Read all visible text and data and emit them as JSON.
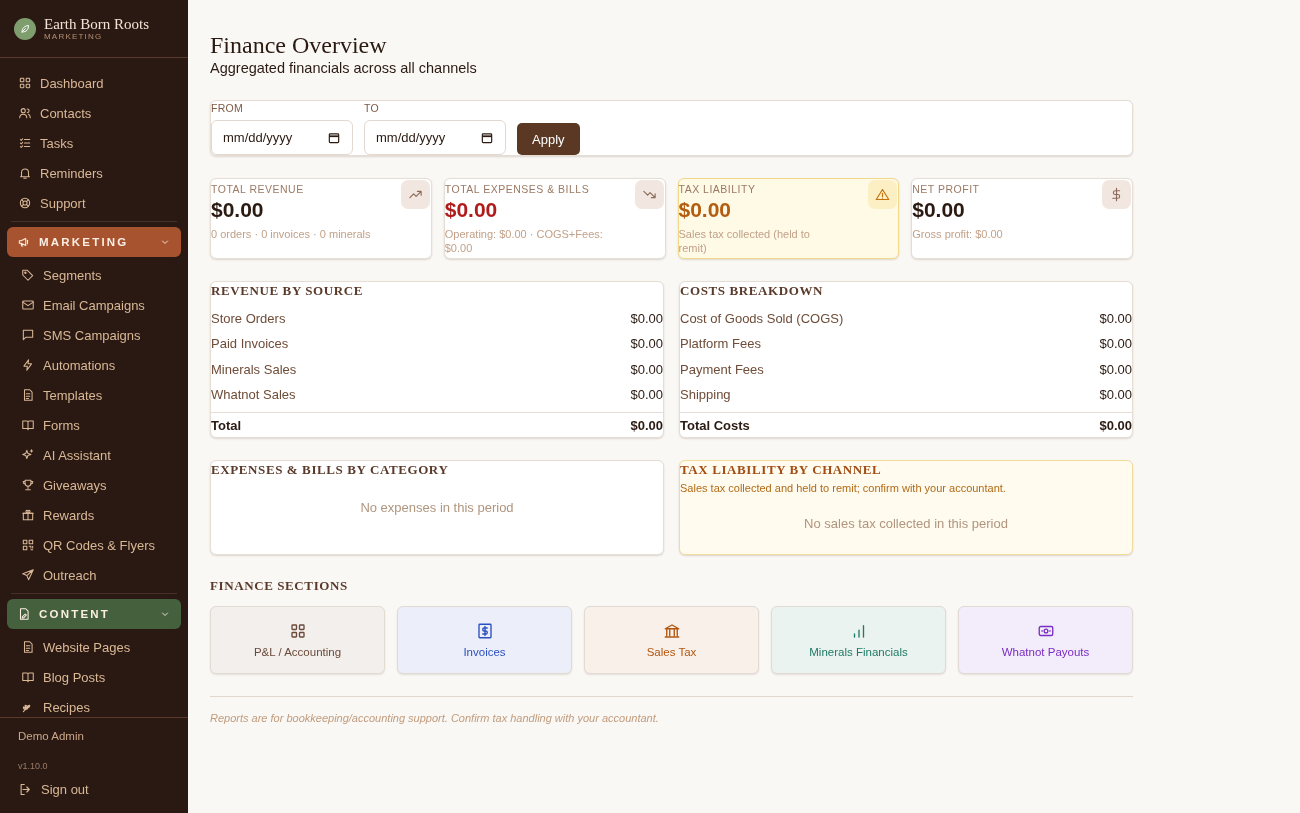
{
  "brand": {
    "name": "Earth Born Roots",
    "subtitle": "MARKETING"
  },
  "nav": [
    {
      "kind": "link",
      "label": "Dashboard"
    },
    {
      "kind": "link",
      "label": "Contacts"
    },
    {
      "kind": "link",
      "label": "Tasks"
    },
    {
      "kind": "link",
      "label": "Reminders"
    },
    {
      "kind": "link",
      "label": "Support"
    },
    {
      "kind": "group",
      "label": "MARKETING",
      "color": "#a8532f",
      "expanded": true
    },
    {
      "kind": "sublink",
      "label": "Segments"
    },
    {
      "kind": "sublink",
      "label": "Email Campaigns"
    },
    {
      "kind": "sublink",
      "label": "SMS Campaigns"
    },
    {
      "kind": "sublink",
      "label": "Automations"
    },
    {
      "kind": "sublink",
      "label": "Templates"
    },
    {
      "kind": "sublink",
      "label": "Forms"
    },
    {
      "kind": "sublink",
      "label": "AI Assistant"
    },
    {
      "kind": "sublink",
      "label": "Giveaways"
    },
    {
      "kind": "sublink",
      "label": "Rewards"
    },
    {
      "kind": "sublink",
      "label": "QR Codes & Flyers"
    },
    {
      "kind": "sublink",
      "label": "Outreach"
    },
    {
      "kind": "group",
      "label": "CONTENT",
      "color": "#45603d",
      "expanded": true
    },
    {
      "kind": "sublink",
      "label": "Website Pages"
    },
    {
      "kind": "sublink",
      "label": "Blog Posts"
    },
    {
      "kind": "sublink",
      "label": "Recipes"
    }
  ],
  "user": {
    "name": "Demo Admin",
    "version": "v1.10.0",
    "sign_out": "Sign out"
  },
  "page": {
    "title": "Finance Overview",
    "subtitle": "Aggregated financials across all channels"
  },
  "filters": {
    "from_label": "FROM",
    "from_placeholder": "mm/dd/yyyy",
    "to_label": "TO",
    "to_placeholder": "mm/dd/yyyy",
    "apply": "Apply"
  },
  "stats": [
    {
      "kind": "default",
      "label": "TOTAL REVENUE",
      "value": "$0.00",
      "note": "0 orders · 0 invoices · 0 minerals"
    },
    {
      "kind": "expense",
      "label": "TOTAL EXPENSES & BILLS",
      "value": "$0.00",
      "note": "Operating: $0.00 · COGS+Fees: $0.00"
    },
    {
      "kind": "warning",
      "label": "TAX LIABILITY",
      "value": "$0.00",
      "note": "Sales tax collected (held to remit)"
    },
    {
      "kind": "default",
      "label": "NET PROFIT",
      "value": "$0.00",
      "note": "Gross profit: $0.00"
    }
  ],
  "tables": [
    {
      "title": "REVENUE BY SOURCE",
      "rows": [
        {
          "label": "Store Orders",
          "value": "$0.00"
        },
        {
          "label": "Paid Invoices",
          "value": "$0.00"
        },
        {
          "label": "Minerals Sales",
          "value": "$0.00"
        },
        {
          "label": "Whatnot Sales",
          "value": "$0.00"
        }
      ],
      "total": {
        "label": "Total",
        "value": "$0.00"
      }
    },
    {
      "title": "COSTS BREAKDOWN",
      "rows": [
        {
          "label": "Cost of Goods Sold (COGS)",
          "value": "$0.00"
        },
        {
          "label": "Platform Fees",
          "value": "$0.00"
        },
        {
          "label": "Payment Fees",
          "value": "$0.00"
        },
        {
          "label": "Shipping",
          "value": "$0.00"
        }
      ],
      "total": {
        "label": "Total Costs",
        "value": "$0.00"
      }
    }
  ],
  "panels": [
    {
      "kind": "default",
      "title": "EXPENSES & BILLS BY CATEGORY",
      "empty": "No expenses in this period"
    },
    {
      "kind": "warning",
      "title": "TAX LIABILITY BY CHANNEL",
      "note": "Sales tax collected and held to remit; confirm with your accountant.",
      "empty": "No sales tax collected in this period"
    }
  ],
  "sections": {
    "title": "FINANCE SECTIONS",
    "items": [
      {
        "label": "P&L / Accounting",
        "color": "#6b4a3a"
      },
      {
        "label": "Invoices",
        "color": "#2b50c0"
      },
      {
        "label": "Sales Tax",
        "color": "#b2560f"
      },
      {
        "label": "Minerals Financials",
        "color": "#1f7a66"
      },
      {
        "label": "Whatnot Payouts",
        "color": "#7a2fc4"
      }
    ]
  },
  "footer": "Reports are for bookkeeping/accounting support. Confirm tax handling with your accountant."
}
